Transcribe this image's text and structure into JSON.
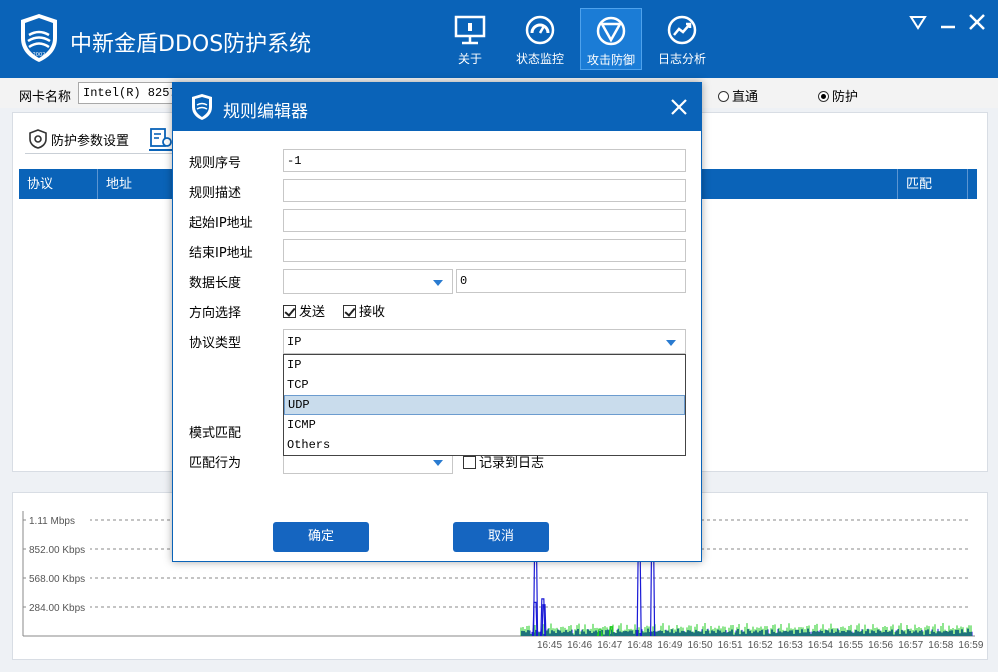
{
  "app": {
    "title": "中新金盾DDOS防护系统",
    "logo_text": "2002"
  },
  "nav": [
    {
      "label": "关于",
      "icon": "monitor-icon"
    },
    {
      "label": "状态监控",
      "icon": "gauge-icon"
    },
    {
      "label": "攻击防御",
      "icon": "shield-filter-icon",
      "active": true
    },
    {
      "label": "日志分析",
      "icon": "chart-icon"
    }
  ],
  "nic": {
    "label": "网卡名称",
    "value": "Intel(R) 8257",
    "mode_options": [
      {
        "label": "直通",
        "checked": false
      },
      {
        "label": "防护",
        "checked": true
      }
    ]
  },
  "panel": {
    "tab_protect_settings": "防护参数设置",
    "table_headers": [
      "协议",
      "地址",
      "匹配"
    ]
  },
  "chart_data": {
    "type": "line",
    "title": "",
    "yticks": [
      "1.11 Mbps",
      "852.00 Kbps",
      "568.00 Kbps",
      "284.00 Kbps"
    ],
    "xticks": [
      "16:45",
      "16:46",
      "16:47",
      "16:48",
      "16:49",
      "16:50",
      "16:51",
      "16:52",
      "16:53",
      "16:54",
      "16:55",
      "16:56",
      "16:57",
      "16:58",
      "16:59"
    ],
    "series": [
      {
        "color": "#1a1ad6",
        "spikes": [
          [
            16.7,
            0.29
          ],
          [
            16.75,
            0.74
          ],
          [
            17.4,
            0.32
          ],
          [
            17.5,
            0.27
          ],
          [
            26.0,
            0.72
          ],
          [
            27.2,
            0.82
          ]
        ]
      },
      {
        "color": "#22cc22",
        "spikes": [
          [
            22.5,
            0.06
          ],
          [
            23.5,
            0.08
          ]
        ]
      }
    ]
  },
  "dialog": {
    "title": "规则编辑器",
    "fields": {
      "rule_id": {
        "label": "规则序号",
        "value": "-1"
      },
      "rule_desc": {
        "label": "规则描述",
        "value": ""
      },
      "start_ip": {
        "label": "起始IP地址",
        "value": ""
      },
      "end_ip": {
        "label": "结束IP地址",
        "value": ""
      },
      "data_length": {
        "label": "数据长度",
        "select_value": "",
        "value": "0"
      },
      "direction": {
        "label": "方向选择",
        "send": "发送",
        "receive": "接收",
        "send_checked": true,
        "receive_checked": true
      },
      "protocol": {
        "label": "协议类型",
        "value": "IP",
        "options": [
          "IP",
          "TCP",
          "UDP",
          "ICMP",
          "Others"
        ],
        "highlighted": "UDP"
      },
      "pattern": {
        "label": "模式匹配"
      },
      "action": {
        "label": "匹配行为",
        "value": "",
        "log_label": "记录到日志",
        "log_checked": false
      }
    },
    "ok_label": "确定",
    "cancel_label": "取消"
  },
  "colors": {
    "brand": "#0a63b8",
    "button": "#1565c0",
    "highlight": "#c9dcec"
  }
}
